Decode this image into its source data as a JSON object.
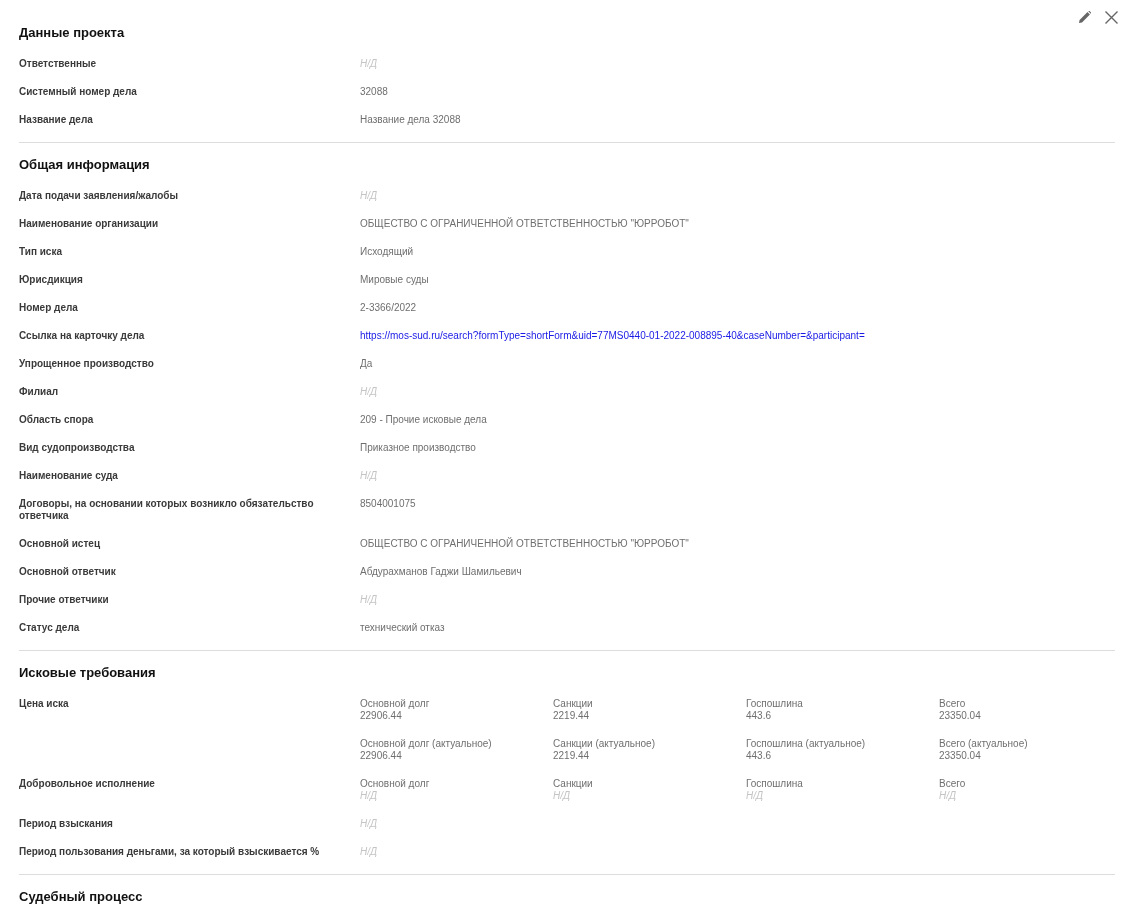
{
  "sections": [
    {
      "title": "Данные проекта",
      "fields": [
        {
          "label": "Ответственные",
          "kind": "na",
          "value": "Н/Д"
        },
        {
          "label": "Системный номер дела",
          "kind": "text",
          "value": "32088"
        },
        {
          "label": "Название дела",
          "kind": "text",
          "value": "Название дела 32088"
        }
      ]
    },
    {
      "title": "Общая информация",
      "fields": [
        {
          "label": "Дата подачи заявления/жалобы",
          "kind": "na",
          "value": "Н/Д"
        },
        {
          "label": "Наименование организации",
          "kind": "text",
          "value": "ОБЩЕСТВО С ОГРАНИЧЕННОЙ ОТВЕТСТВЕННОСТЬЮ \"ЮРРОБОТ\""
        },
        {
          "label": "Тип иска",
          "kind": "text",
          "value": "Исходящий"
        },
        {
          "label": "Юрисдикция",
          "kind": "text",
          "value": "Мировые суды"
        },
        {
          "label": "Номер дела",
          "kind": "text",
          "value": "2-3366/2022"
        },
        {
          "label": "Ссылка на карточку дела",
          "kind": "link",
          "value": "https://mos-sud.ru/search?formType=shortForm&uid=77MS0440-01-2022-008895-40&caseNumber=&participant="
        },
        {
          "label": "Упрощенное производство",
          "kind": "text",
          "value": "Да"
        },
        {
          "label": "Филиал",
          "kind": "na",
          "value": "Н/Д"
        },
        {
          "label": "Область спора",
          "kind": "text",
          "value": "209 - Прочие исковые дела"
        },
        {
          "label": "Вид судопроизводства",
          "kind": "text",
          "value": "Приказное производство"
        },
        {
          "label": "Наименование суда",
          "kind": "na",
          "value": "Н/Д"
        },
        {
          "label": "Договоры, на основании которых возникло обязательство ответчика",
          "kind": "text",
          "value": "8504001075"
        },
        {
          "label": "Основной истец",
          "kind": "text",
          "value": "ОБЩЕСТВО С ОГРАНИЧЕННОЙ ОТВЕТСТВЕННОСТЬЮ \"ЮРРОБОТ\""
        },
        {
          "label": "Основной ответчик",
          "kind": "text",
          "value": "Абдурахманов Гаджи Шамильевич"
        },
        {
          "label": "Прочие ответчики",
          "kind": "na",
          "value": "Н/Д"
        },
        {
          "label": "Статус дела",
          "kind": "text",
          "value": "технический отказ"
        }
      ]
    },
    {
      "title": "Исковые требования",
      "fields": [
        {
          "label": "Цена иска",
          "kind": "amounts",
          "lines": [
            [
              {
                "caption": "Основной долг",
                "value": "22906.44",
                "missing": false
              },
              {
                "caption": "Санкции",
                "value": "2219.44",
                "missing": false
              },
              {
                "caption": "Госпошлина",
                "value": "443.6",
                "missing": false
              },
              {
                "caption": "Всего",
                "value": "23350.04",
                "missing": false
              }
            ],
            [
              {
                "caption": "Основной долг (актуальное)",
                "value": "22906.44",
                "missing": false
              },
              {
                "caption": "Санкции (актуальное)",
                "value": "2219.44",
                "missing": false
              },
              {
                "caption": "Госпошлина (актуальное)",
                "value": "443.6",
                "missing": false
              },
              {
                "caption": "Всего (актуальное)",
                "value": "23350.04",
                "missing": false
              }
            ]
          ]
        },
        {
          "label": "Добровольное исполнение",
          "kind": "amounts",
          "lines": [
            [
              {
                "caption": "Основной долг",
                "value": "Н/Д",
                "missing": true
              },
              {
                "caption": "Санкции",
                "value": "Н/Д",
                "missing": true
              },
              {
                "caption": "Госпошлина",
                "value": "Н/Д",
                "missing": true
              },
              {
                "caption": "Всего",
                "value": "Н/Д",
                "missing": true
              }
            ]
          ]
        },
        {
          "label": "Период взыскания",
          "kind": "na",
          "value": "Н/Д"
        },
        {
          "label": "Период пользования деньгами, за который взыскивается %",
          "kind": "na",
          "value": "Н/Д"
        }
      ]
    },
    {
      "title": "Судебный процесс"
    }
  ]
}
